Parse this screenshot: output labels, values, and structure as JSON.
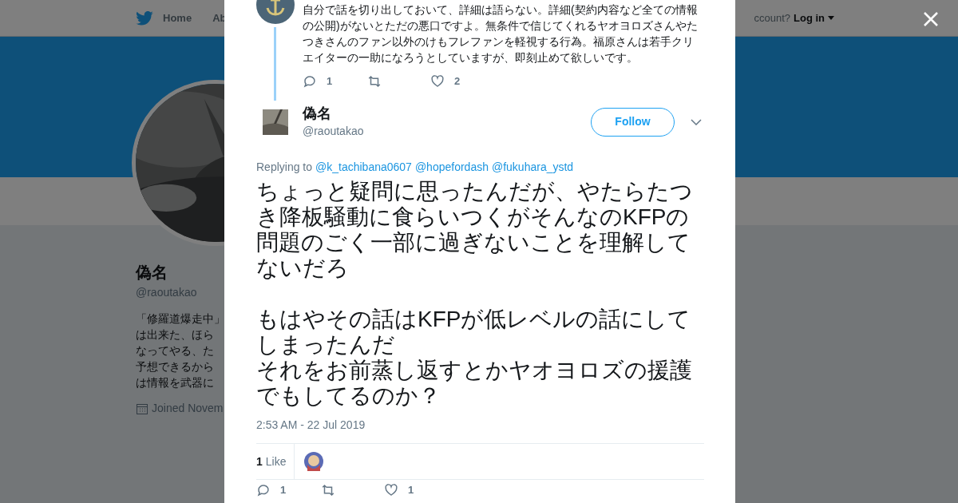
{
  "nav": {
    "items": [
      "Home",
      "Ab"
    ],
    "login_prompt": "ccount?",
    "login": "Log in"
  },
  "profile": {
    "name": "偽名",
    "handle": "@raoutakao",
    "bio_lines": [
      "「修羅道爆走中」",
      "は出来た、ほら",
      "なってやる、た",
      "予想できるから",
      "は情報を武器に"
    ],
    "joined": "Joined Novem"
  },
  "modal": {
    "parent_tweet": {
      "text": "自分で話を切り出しておいて、詳細は語らない。詳細(契約内容など全ての情報の公開)がないとただの悪口ですよ。無条件で信じてくれるヤオヨロズさんやたつきさんのファン以外のけもフレファンを軽視する行為。福原さんは若手クリエイターの一助になろうとしていますが、即刻止めて欲しいです。",
      "replies": "1",
      "likes": "2"
    },
    "tweet": {
      "name": "偽名",
      "handle": "@raoutakao",
      "follow": "Follow",
      "replying_label": "Replying to",
      "replying_to": [
        "@k_tachibana0607",
        "@hopefordash",
        "@fukuhara_ystd"
      ],
      "paragraphs": [
        [
          "ちょっと疑問に思ったんだが、やたらたつき降板騒動に食らいつくがそんなのKFPの問題のごく一部に過ぎないことを理解してないだろ"
        ],
        [
          "もはやその話はKFPが低レベルの話にしてしまったんだ",
          "それをお前蒸し返すとかヤオヨロズの援護でもしてるのか？"
        ]
      ],
      "time": "2:53 AM - 22 Jul 2019",
      "like_count": "1",
      "like_label": "Like",
      "replies": "1",
      "likes": "1"
    }
  }
}
